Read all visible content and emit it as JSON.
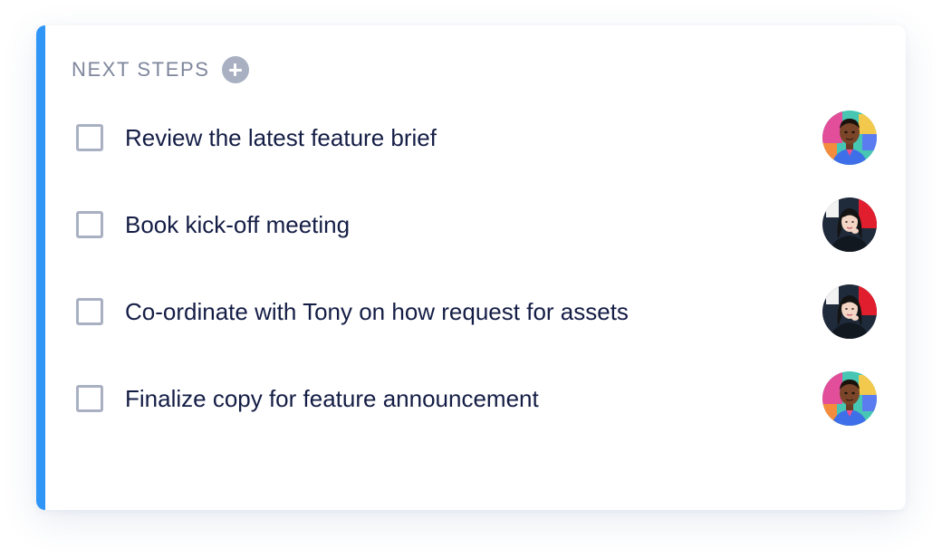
{
  "section": {
    "title": "NEXT STEPS"
  },
  "tasks": [
    {
      "label": "Review the latest feature brief",
      "avatar": "man-avatar"
    },
    {
      "label": "Book kick-off meeting",
      "avatar": "woman-avatar"
    },
    {
      "label": "Co-ordinate with Tony on how request for assets",
      "avatar": "woman-avatar"
    },
    {
      "label": "Finalize copy for feature announcement",
      "avatar": "man-avatar"
    }
  ],
  "colors": {
    "accent": "#2f95f6",
    "title": "#7e869c",
    "text": "#141d45",
    "checkbox_border": "#a8b0c2"
  }
}
